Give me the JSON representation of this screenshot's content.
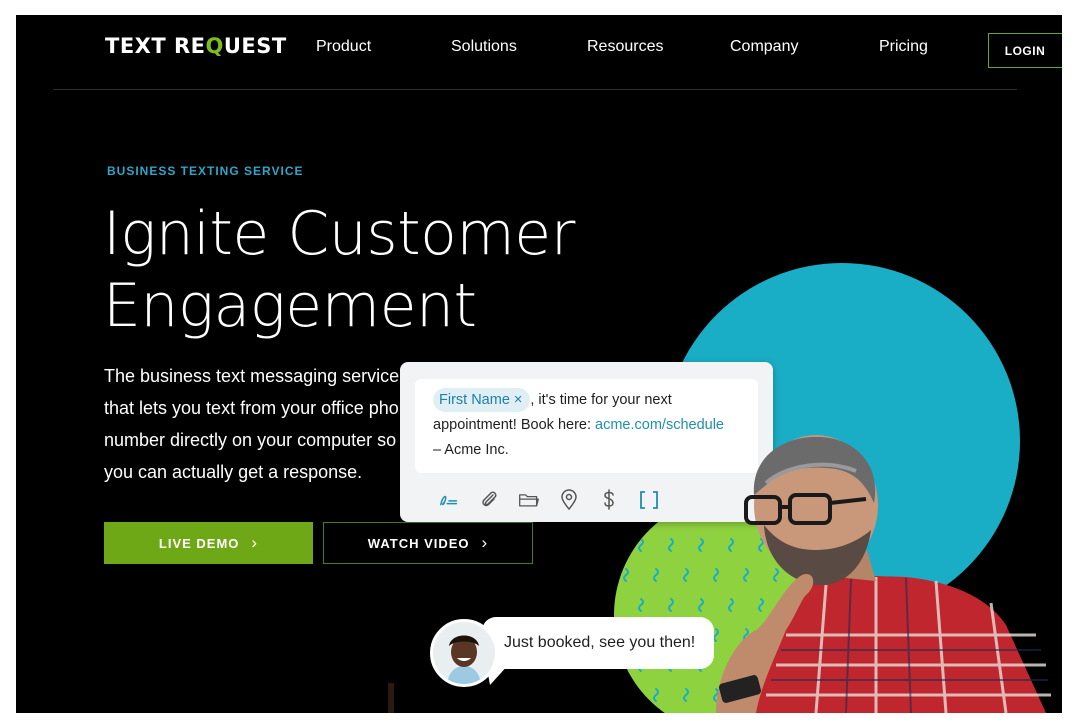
{
  "nav": {
    "logo_part1": "TEXT RE",
    "logo_q": "Q",
    "logo_part2": "UEST",
    "items": [
      "Product",
      "Solutions",
      "Resources",
      "Company",
      "Pricing"
    ],
    "login": "LOGIN"
  },
  "hero": {
    "eyebrow": "BUSINESS TEXTING SERVICE",
    "headline": [
      "Ignite Customer",
      "Engagement"
    ],
    "lede": [
      "The business text messaging service",
      "that lets you text from your office phone",
      "number directly on your computer so",
      "you can actually get a response."
    ],
    "cta_primary": "LIVE DEMO",
    "cta_secondary": "WATCH VIDEO"
  },
  "composer": {
    "tag": "First Name",
    "tag_close": "×",
    "text_after_tag": ", it's time for your next appointment! Book here: ",
    "link": "acme.com/schedule",
    "signature": " – Acme Inc.",
    "tools": [
      "signature-icon",
      "paperclip-icon",
      "folder-icon",
      "location-pin-icon",
      "dollar-icon",
      "brackets-icon"
    ]
  },
  "chat": {
    "reply": "Just booked, see you then!"
  },
  "colors": {
    "background": "#000000",
    "brand_green": "#6fa817",
    "accent_teal": "#19aec6",
    "eyebrow_blue": "#2fa6c9",
    "lime_circle": "#8fd23f"
  }
}
